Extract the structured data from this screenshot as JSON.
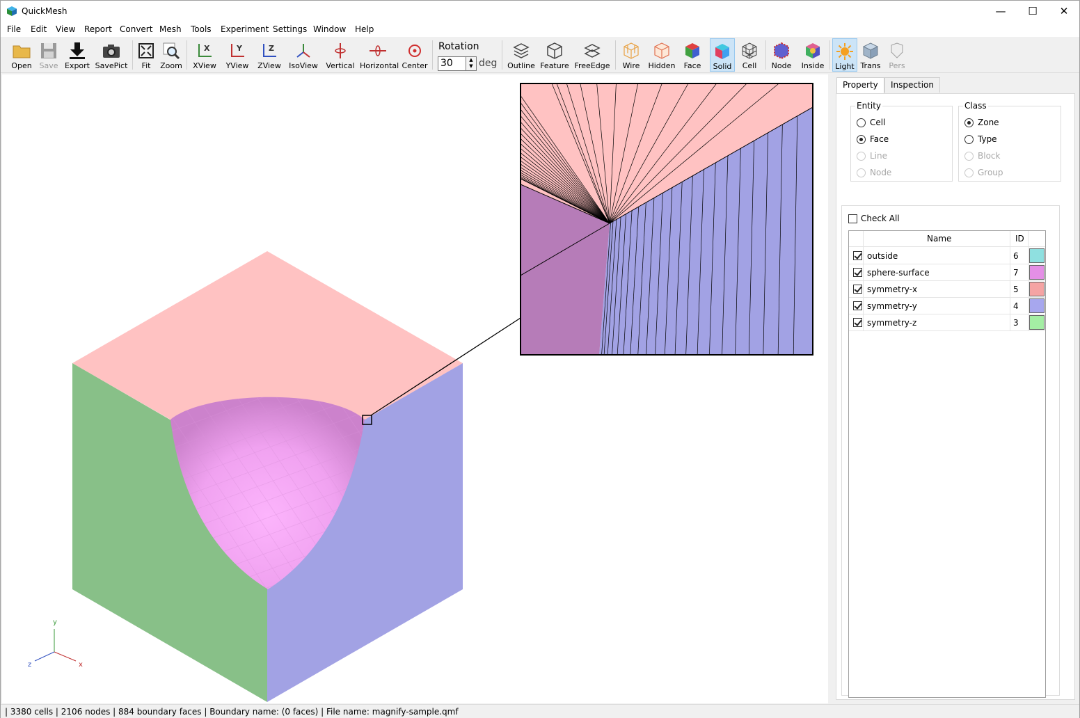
{
  "window": {
    "title": "QuickMesh",
    "minimize": "—",
    "maximize": "☐",
    "close": "✕"
  },
  "menu": [
    "File",
    "Edit",
    "View",
    "Report",
    "Convert",
    "Mesh",
    "Tools",
    "Experiment",
    "Settings",
    "Window",
    "Help"
  ],
  "toolbar": {
    "open": "Open",
    "save": "Save",
    "export": "Export",
    "savepict": "SavePict",
    "fit": "Fit",
    "zoom": "Zoom",
    "xview": "XView",
    "yview": "YView",
    "zview": "ZView",
    "isoview": "IsoView",
    "vertical": "Vertical",
    "horizontal": "Horizontal",
    "center": "Center",
    "rotation_label": "Rotation",
    "rotation_value": "30",
    "rotation_unit": "deg",
    "outline": "Outline",
    "feature": "Feature",
    "freeedge": "FreeEdge",
    "wire": "Wire",
    "hidden": "Hidden",
    "face": "Face",
    "solid": "Solid",
    "cell": "Cell",
    "node": "Node",
    "inside": "Inside",
    "light": "Light",
    "trans": "Trans",
    "pers": "Pers"
  },
  "axes": {
    "x": "x",
    "y": "y",
    "z": "z"
  },
  "panel": {
    "tabs": {
      "property": "Property",
      "inspection": "Inspection"
    },
    "entity": {
      "title": "Entity",
      "cell": "Cell",
      "face": "Face",
      "line": "Line",
      "node": "Node",
      "selected": "Face"
    },
    "class": {
      "title": "Class",
      "zone": "Zone",
      "type": "Type",
      "block": "Block",
      "group": "Group",
      "selected": "Zone"
    },
    "check_all": "Check All",
    "table": {
      "col_name": "Name",
      "col_id": "ID",
      "rows": [
        {
          "name": "outside",
          "id": "6",
          "color": "#8fe0e0",
          "checked": true
        },
        {
          "name": "sphere-surface",
          "id": "7",
          "color": "#e48fe6",
          "checked": true
        },
        {
          "name": "symmetry-x",
          "id": "5",
          "color": "#f5a4a4",
          "checked": true
        },
        {
          "name": "symmetry-y",
          "id": "4",
          "color": "#a7a7ee",
          "checked": true
        },
        {
          "name": "symmetry-z",
          "id": "3",
          "color": "#a4eea4",
          "checked": true
        }
      ]
    }
  },
  "colors": {
    "top_face": "#ffc2c2",
    "left_face": "#88c088",
    "right_face": "#a2a2e4",
    "sphere": "#f3a2f3",
    "zoom_left": "#b67cb8"
  },
  "status": " | 3380 cells | 2106 nodes | 884 boundary faces |  Boundary name:  (0 faces) | File name: magnify-sample.qmf"
}
